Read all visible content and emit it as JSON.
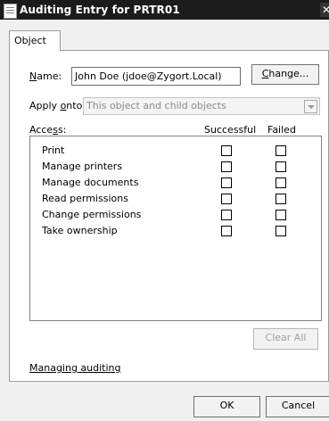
{
  "window": {
    "title": "Auditing Entry for PRTR01",
    "close_glyph": "✕",
    "app_icon": "document-icon"
  },
  "tabs": [
    {
      "label": "Object"
    }
  ],
  "name_field": {
    "label_prefix": "N",
    "label_rest": "ame:",
    "value": "John Doe (jdoe@Zygort.Local)",
    "change_prefix": "C",
    "change_rest": "hange..."
  },
  "apply_onto": {
    "label_a": "Apply ",
    "label_acc": "o",
    "label_b": "nto:",
    "value": "This object and child objects"
  },
  "access": {
    "label_a": "Acce",
    "label_acc": "s",
    "label_b": "s:",
    "successful_header": "Successful",
    "failed_header": "Failed",
    "rows": [
      {
        "name": "Print",
        "successful": false,
        "failed": false
      },
      {
        "name": "Manage printers",
        "successful": false,
        "failed": false
      },
      {
        "name": "Manage documents",
        "successful": false,
        "failed": false
      },
      {
        "name": "Read permissions",
        "successful": false,
        "failed": false
      },
      {
        "name": "Change permissions",
        "successful": false,
        "failed": false
      },
      {
        "name": "Take ownership",
        "successful": false,
        "failed": false
      }
    ]
  },
  "clear_all_label": "Clear All",
  "link_label": "Managing auditing",
  "ok_label": "OK",
  "cancel_label": "Cancel"
}
